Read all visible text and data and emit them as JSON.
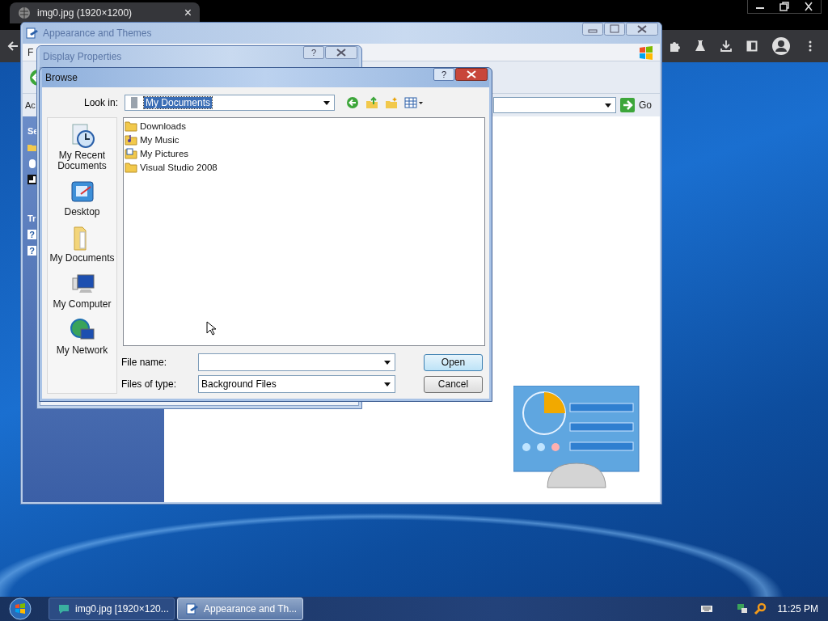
{
  "browser": {
    "tab_title": "img0.jpg (1920×1200)",
    "tab_close": "×"
  },
  "back_window": {
    "title": "Appearance and Themes",
    "menu_fragment": "F",
    "address_fragment": "Ac",
    "go": "Go",
    "side_fragments": [
      "Se",
      "Tr"
    ],
    "side_help_marks": [
      "?",
      "?"
    ]
  },
  "middle_window": {
    "title": "Display Properties",
    "help": "?"
  },
  "dialog": {
    "title": "Browse",
    "help": "?",
    "look_in_label": "Look in:",
    "look_in_value": "My Documents",
    "places": [
      {
        "label": "My Recent Documents",
        "kind": "recent"
      },
      {
        "label": "Desktop",
        "kind": "desktop"
      },
      {
        "label": "My Documents",
        "kind": "documents"
      },
      {
        "label": "My Computer",
        "kind": "computer"
      },
      {
        "label": "My Network",
        "kind": "network"
      }
    ],
    "files": [
      {
        "name": "Downloads",
        "kind": "folder"
      },
      {
        "name": "My Music",
        "kind": "music"
      },
      {
        "name": "My Pictures",
        "kind": "pictures"
      },
      {
        "name": "Visual Studio 2008",
        "kind": "folder"
      }
    ],
    "file_name_label": "File name:",
    "file_type_label": "Files of type:",
    "file_type_value": "Background Files",
    "buttons": [
      "Open",
      "Cancel"
    ]
  },
  "taskbar": {
    "items": [
      {
        "label": "img0.jpg [1920×120...",
        "selected": false
      },
      {
        "label": "Appearance and Th...",
        "selected": true
      }
    ],
    "clock": "11:25 PM"
  }
}
